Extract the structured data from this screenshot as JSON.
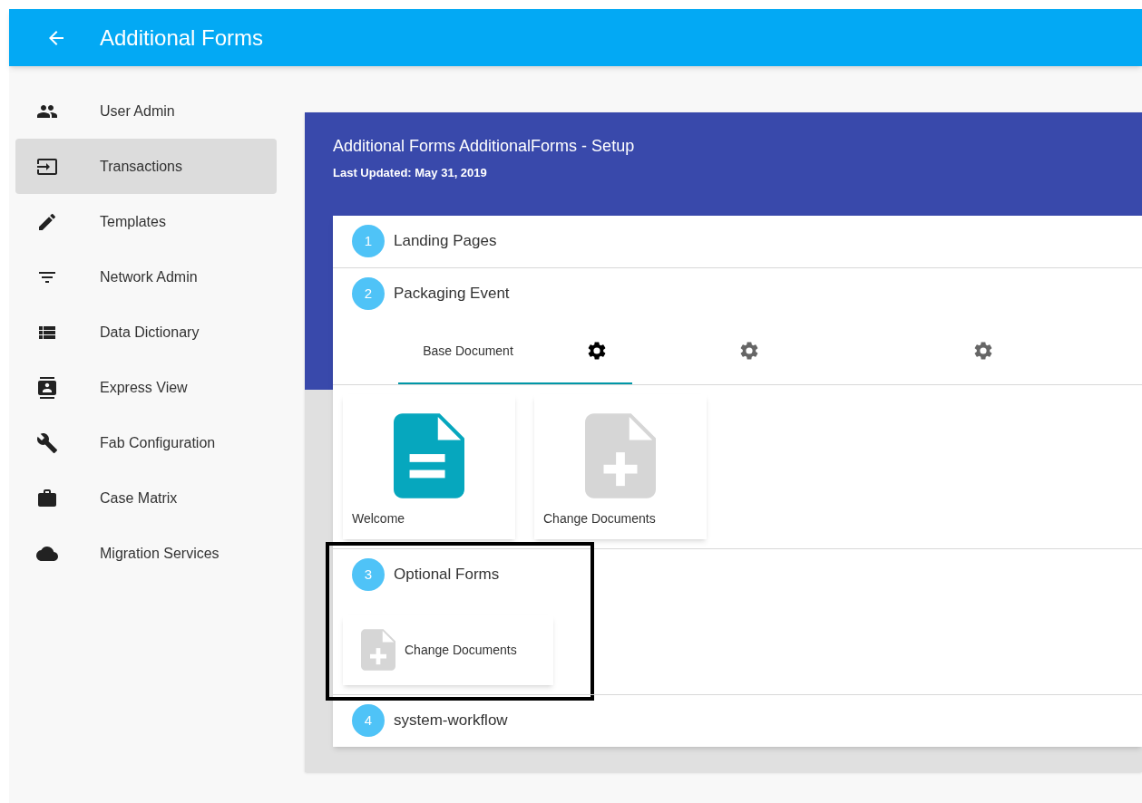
{
  "app_bar": {
    "title": "Additional Forms"
  },
  "sidebar": {
    "items": [
      {
        "label": "User Admin",
        "kind": "people",
        "selected": false
      },
      {
        "label": "Transactions",
        "kind": "input",
        "selected": true
      },
      {
        "label": "Templates",
        "kind": "pencil",
        "selected": false
      },
      {
        "label": "Network Admin",
        "kind": "filter",
        "selected": false
      },
      {
        "label": "Data Dictionary",
        "kind": "list",
        "selected": false
      },
      {
        "label": "Express View",
        "kind": "contact",
        "selected": false
      },
      {
        "label": "Fab Configuration",
        "kind": "wrench",
        "selected": false
      },
      {
        "label": "Case Matrix",
        "kind": "briefcase",
        "selected": false
      },
      {
        "label": "Migration Services",
        "kind": "cloud",
        "selected": false
      }
    ]
  },
  "header": {
    "title": "Additional Forms AdditionalForms - Setup",
    "subtitle": "Last Updated: May 31, 2019"
  },
  "steps": [
    {
      "number": "1",
      "title": "Landing Pages",
      "highlighted": false
    },
    {
      "number": "2",
      "title": "Packaging Event",
      "highlighted": false,
      "tabs": [
        {
          "label": "Base Document",
          "selected": true
        },
        {
          "selected": false
        },
        {
          "selected": false
        }
      ],
      "cards": [
        {
          "kind": "document",
          "label": "Welcome"
        },
        {
          "kind": "add",
          "label": "Change Documents"
        }
      ]
    },
    {
      "number": "3",
      "title": "Optional Forms",
      "highlighted": true,
      "small_cards": [
        {
          "kind": "add",
          "label": "Change Documents"
        }
      ]
    },
    {
      "number": "4",
      "title": "system-workflow",
      "highlighted": false
    }
  ]
}
